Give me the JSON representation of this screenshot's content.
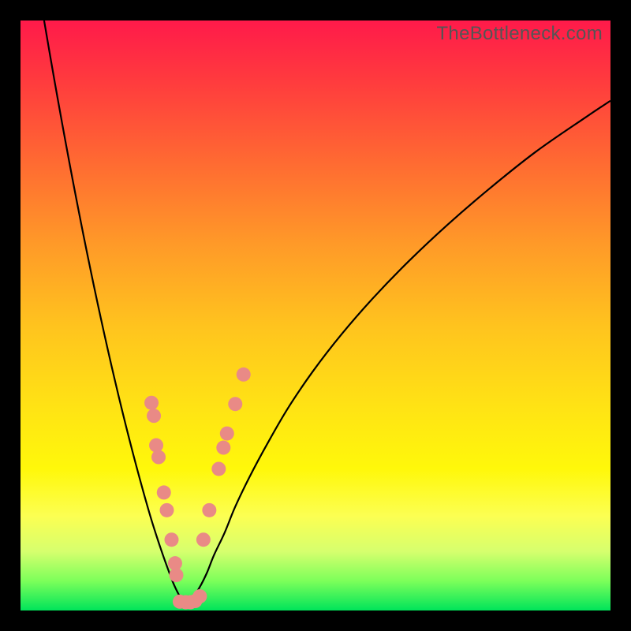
{
  "watermark": "TheBottleneck.com",
  "colors": {
    "frame": "#000000",
    "curve_stroke": "#000000",
    "marker_fill": "#e98a86",
    "marker_stroke": "#d06d68",
    "gradient_top": "#ff1a4a",
    "gradient_bottom": "#00e45a"
  },
  "chart_data": {
    "type": "line",
    "title": "",
    "xlabel": "",
    "ylabel": "",
    "ylim": [
      0,
      100
    ],
    "xlim": [
      0,
      100
    ],
    "series": [
      {
        "name": "left-curve",
        "x": [
          4.0,
          5.2,
          6.4,
          7.6,
          8.8,
          10.0,
          11.2,
          12.4,
          13.6,
          14.8,
          16.0,
          17.2,
          18.4,
          19.6,
          20.8,
          22.0,
          23.0,
          24.0,
          25.0,
          26.0,
          27.0,
          28.0
        ],
        "y": [
          100.0,
          93.0,
          86.2,
          79.6,
          73.2,
          67.0,
          61.0,
          55.2,
          49.6,
          44.2,
          39.0,
          34.0,
          29.2,
          24.6,
          20.2,
          16.0,
          12.8,
          9.8,
          7.0,
          4.4,
          2.4,
          1.0
        ]
      },
      {
        "name": "right-curve",
        "x": [
          28.0,
          29.2,
          30.4,
          31.6,
          32.8,
          34.6,
          36.4,
          38.8,
          41.8,
          45.4,
          49.6,
          54.4,
          59.8,
          65.8,
          72.4,
          79.6,
          87.4,
          95.8,
          100.0
        ],
        "y": [
          1.0,
          2.2,
          4.0,
          6.4,
          9.4,
          13.2,
          17.6,
          22.6,
          28.2,
          34.4,
          40.6,
          46.8,
          53.0,
          59.2,
          65.4,
          71.6,
          77.8,
          83.6,
          86.4
        ]
      },
      {
        "name": "markers-left-branch",
        "x": [
          22.2,
          22.6,
          23.0,
          23.4,
          24.3,
          24.8,
          25.6,
          26.2,
          26.4
        ],
        "y": [
          35.2,
          33.0,
          28.0,
          26.0,
          20.0,
          17.0,
          12.0,
          8.0,
          6.0
        ]
      },
      {
        "name": "markers-right-branch",
        "x": [
          31.0,
          32.0,
          33.6,
          34.4,
          35.0,
          36.4,
          37.8
        ],
        "y": [
          12.0,
          17.0,
          24.0,
          27.6,
          30.0,
          35.0,
          40.0
        ]
      },
      {
        "name": "markers-bottom",
        "x": [
          27.0,
          28.0,
          28.8,
          29.6,
          30.4
        ],
        "y": [
          1.5,
          1.4,
          1.4,
          1.6,
          2.4
        ]
      }
    ]
  }
}
